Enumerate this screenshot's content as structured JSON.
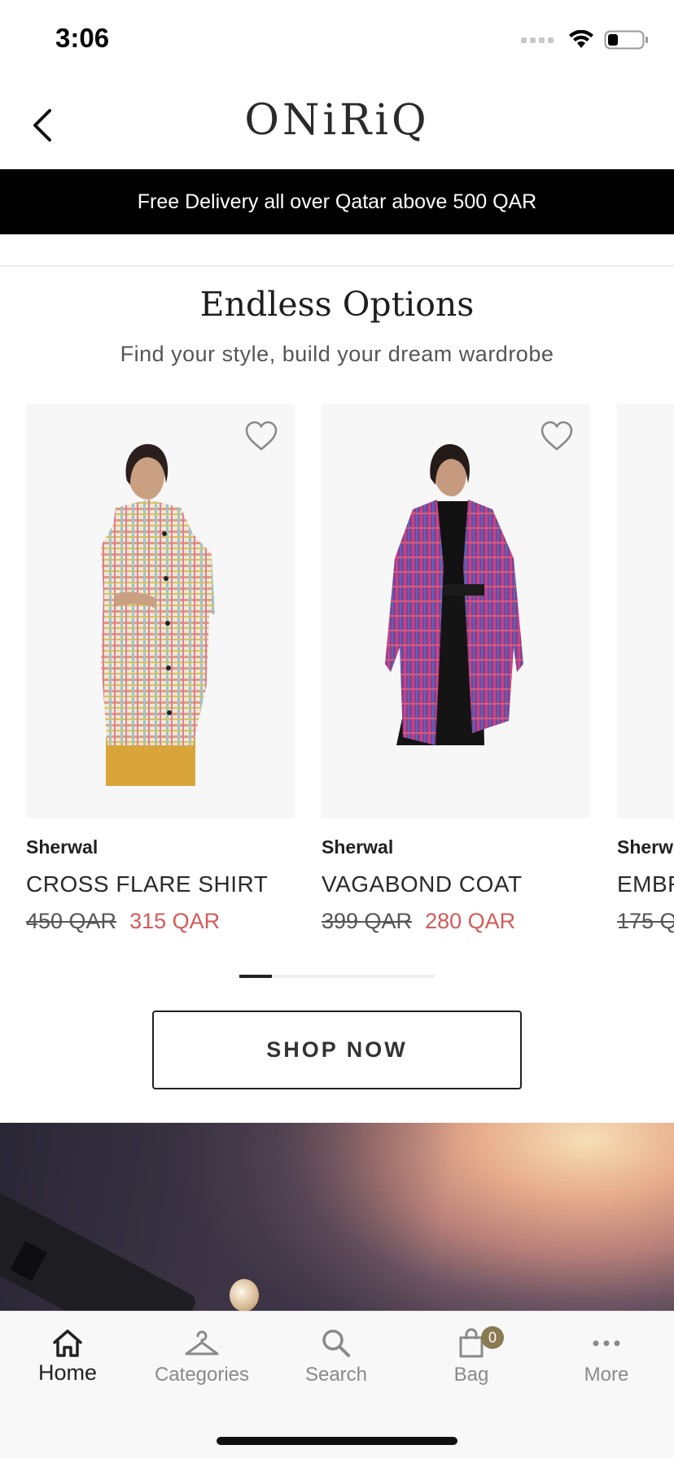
{
  "status_bar": {
    "time": "3:06"
  },
  "header": {
    "logo": "ONiRiQ"
  },
  "promo": {
    "text": "Free Delivery all over Qatar above 500 QAR"
  },
  "section": {
    "title": "Endless Options",
    "subtitle": "Find your style, build your dream wardrobe"
  },
  "products": [
    {
      "brand": "Sherwal",
      "name": "CROSS FLARE SHIRT",
      "old_price": "450 QAR",
      "new_price": "315 QAR"
    },
    {
      "brand": "Sherwal",
      "name": "VAGABOND COAT",
      "old_price": "399 QAR",
      "new_price": "280 QAR"
    },
    {
      "brand": "Sherw",
      "name": "EMBR",
      "old_price": "175 Q",
      "new_price": ""
    }
  ],
  "cta": {
    "shop_now": "SHOP NOW"
  },
  "tabbar": {
    "home": "Home",
    "categories": "Categories",
    "search": "Search",
    "bag": "Bag",
    "bag_count": "0",
    "more": "More"
  },
  "colors": {
    "sale_price": "#d25b5b",
    "promo_bg": "#000000",
    "badge": "#8a7a52"
  }
}
